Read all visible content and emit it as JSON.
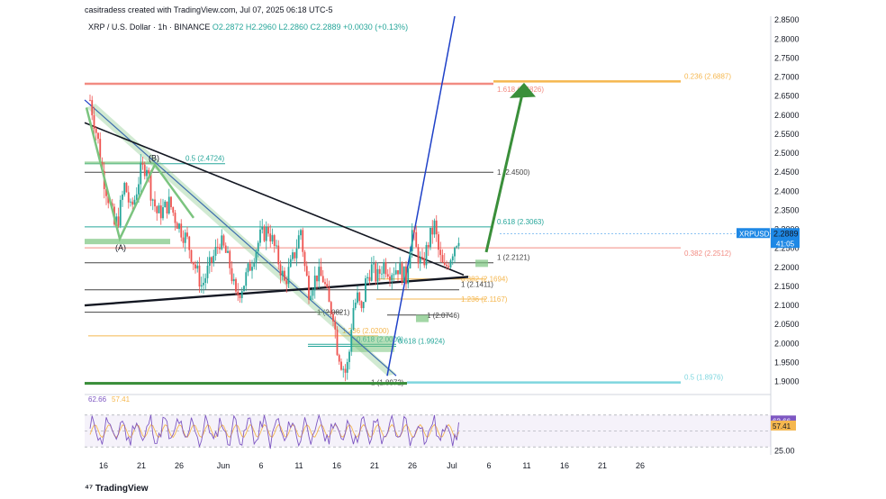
{
  "header": {
    "credit": "casitradess created with TradingView.com, Jul 07, 2025 06:18 UTC-5",
    "symbol_line": "XRP / U.S. Dollar · 1h · BINANCE",
    "ohlc": "O2.2872  H2.2960  L2.2860  C2.2889  +0.0030 (+0.13%)"
  },
  "brand": {
    "logo": "tradingview-logo",
    "label": "TradingView"
  },
  "colors": {
    "up": "#26a69a",
    "down": "#ef5350",
    "fib_orange": "#f5b74f",
    "fib_red": "#f28b82",
    "fib_teal": "#26a69a",
    "fib_cyan": "#7fd6df",
    "trend_blue": "#1e40c8",
    "arrow_green": "#3a8f3a",
    "rsi": "#7e57c2",
    "rsi_ma": "#f5b74f",
    "price_badge": "#1e88e5"
  },
  "chart_data": [
    {
      "type": "candlestick",
      "symbol": "XRPUSD",
      "timeframe": "1h",
      "ylim": [
        1.88,
        2.86
      ],
      "y_ticks": [
        "2.8500",
        "2.8000",
        "2.7500",
        "2.7000",
        "2.6500",
        "2.6000",
        "2.5500",
        "2.5000",
        "2.4500",
        "2.4000",
        "2.3500",
        "2.3000",
        "2.2500",
        "2.2000",
        "2.1500",
        "2.1000",
        "2.0500",
        "2.0000",
        "1.9500",
        "1.9000"
      ],
      "x_ticks": [
        "16",
        "21",
        "26",
        "Jun",
        "6",
        "11",
        "16",
        "21",
        "26",
        "Jul",
        "6",
        "11",
        "16",
        "21",
        "26"
      ],
      "last_price": {
        "label": "XRPUSD",
        "value": "2.2889",
        "countdown": "41:05"
      },
      "price_path": [
        {
          "x": 0.0,
          "y": 2.64
        },
        {
          "x": 1.0,
          "y": 2.53
        },
        {
          "x": 1.5,
          "y": 2.45
        },
        {
          "x": 2.3,
          "y": 2.38
        },
        {
          "x": 3.0,
          "y": 2.31
        },
        {
          "x": 3.5,
          "y": 2.33
        },
        {
          "x": 4.3,
          "y": 2.42
        },
        {
          "x": 5.0,
          "y": 2.35
        },
        {
          "x": 5.5,
          "y": 2.38
        },
        {
          "x": 6.2,
          "y": 2.45
        },
        {
          "x": 7.0,
          "y": 2.47
        },
        {
          "x": 7.5,
          "y": 2.4
        },
        {
          "x": 8.3,
          "y": 2.34
        },
        {
          "x": 9.0,
          "y": 2.35
        },
        {
          "x": 9.8,
          "y": 2.37
        },
        {
          "x": 10.5,
          "y": 2.33
        },
        {
          "x": 11.2,
          "y": 2.3
        },
        {
          "x": 12.0,
          "y": 2.27
        },
        {
          "x": 13.0,
          "y": 2.2
        },
        {
          "x": 13.8,
          "y": 2.15
        },
        {
          "x": 14.5,
          "y": 2.19
        },
        {
          "x": 15.3,
          "y": 2.23
        },
        {
          "x": 16.0,
          "y": 2.27
        },
        {
          "x": 16.7,
          "y": 2.24
        },
        {
          "x": 17.3,
          "y": 2.2
        },
        {
          "x": 18.0,
          "y": 2.12
        },
        {
          "x": 19.0,
          "y": 2.16
        },
        {
          "x": 20.0,
          "y": 2.22
        },
        {
          "x": 21.0,
          "y": 2.28
        },
        {
          "x": 22.0,
          "y": 2.3
        },
        {
          "x": 22.5,
          "y": 2.27
        },
        {
          "x": 23.2,
          "y": 2.22
        },
        {
          "x": 24.0,
          "y": 2.16
        },
        {
          "x": 24.7,
          "y": 2.2
        },
        {
          "x": 25.3,
          "y": 2.24
        },
        {
          "x": 26.0,
          "y": 2.3
        },
        {
          "x": 26.5,
          "y": 2.2
        },
        {
          "x": 27.0,
          "y": 2.14
        },
        {
          "x": 28.0,
          "y": 2.18
        },
        {
          "x": 28.8,
          "y": 2.17
        },
        {
          "x": 29.5,
          "y": 2.1
        },
        {
          "x": 30.0,
          "y": 2.08
        },
        {
          "x": 30.5,
          "y": 1.99
        },
        {
          "x": 31.0,
          "y": 1.95
        },
        {
          "x": 31.6,
          "y": 1.92
        },
        {
          "x": 32.0,
          "y": 1.98
        },
        {
          "x": 32.4,
          "y": 2.09
        },
        {
          "x": 33.0,
          "y": 2.12
        },
        {
          "x": 33.5,
          "y": 2.08
        },
        {
          "x": 34.0,
          "y": 2.16
        },
        {
          "x": 34.7,
          "y": 2.2
        },
        {
          "x": 35.4,
          "y": 2.17
        },
        {
          "x": 36.2,
          "y": 2.21
        },
        {
          "x": 37.0,
          "y": 2.19
        },
        {
          "x": 38.0,
          "y": 2.2
        },
        {
          "x": 39.0,
          "y": 2.17
        },
        {
          "x": 39.7,
          "y": 2.3
        },
        {
          "x": 40.3,
          "y": 2.24
        },
        {
          "x": 41.0,
          "y": 2.2
        },
        {
          "x": 41.8,
          "y": 2.27
        },
        {
          "x": 42.5,
          "y": 2.31
        },
        {
          "x": 43.1,
          "y": 2.23
        },
        {
          "x": 43.7,
          "y": 2.19
        },
        {
          "x": 44.3,
          "y": 2.22
        },
        {
          "x": 45.0,
          "y": 2.26
        },
        {
          "x": 45.6,
          "y": 2.289
        }
      ],
      "fib_levels": [
        {
          "price": 2.6826,
          "text": "1.618 (2.6826)",
          "color": "#f28b82"
        },
        {
          "price": 2.6887,
          "text": "0.236 (2.6887)",
          "color": "#f5b74f"
        },
        {
          "price": 2.4724,
          "text": "0.5 (2.4724)",
          "color": "#26a69a"
        },
        {
          "price": 2.45,
          "text": "1 (2.4500)",
          "color": "#444444"
        },
        {
          "price": 2.3063,
          "text": "0.618 (2.3063)",
          "color": "#26a69a"
        },
        {
          "price": 2.2512,
          "text": "0.382 (2.2512)",
          "color": "#f28b82"
        },
        {
          "price": 2.2121,
          "text": "1 (2.2121)",
          "color": "#444444"
        },
        {
          "price": 2.1694,
          "text": "0.382 (2.1694)",
          "color": "#f5b74f"
        },
        {
          "price": 2.1411,
          "text": "1 (2.1411)",
          "color": "#444444"
        },
        {
          "price": 2.1167,
          "text": "1.236 (2.1167)",
          "color": "#f5b74f"
        },
        {
          "price": 2.0821,
          "text": "1 (2.0821)",
          "color": "#444444"
        },
        {
          "price": 2.0746,
          "text": "1 (2.0746)",
          "color": "#444444"
        },
        {
          "price": 2.02,
          "text": "1.236 (2.0200)",
          "color": "#f5b74f"
        },
        {
          "price": 1.9924,
          "text": "0.618 (1.9924)",
          "color": "#26a69a"
        },
        {
          "price": 1.9977,
          "text": "0.618 (2.0009)",
          "color": "#26a69a"
        },
        {
          "price": 1.8972,
          "text": "1 (1.8972)",
          "color": "#444444"
        },
        {
          "price": 1.8976,
          "text": "0.5 (1.8976)",
          "color": "#7fd6df"
        }
      ],
      "wave_labels": [
        "(B)",
        "(A)"
      ],
      "annotations": [
        "arrow-up-target-2.68"
      ]
    },
    {
      "type": "line",
      "name": "RSI",
      "ylim": [
        20,
        80
      ],
      "levels": [
        70,
        50,
        30
      ],
      "y_ticks": [
        "25.00"
      ],
      "rsi_value": "62.66",
      "rsi_ma_value": "57.41"
    }
  ]
}
